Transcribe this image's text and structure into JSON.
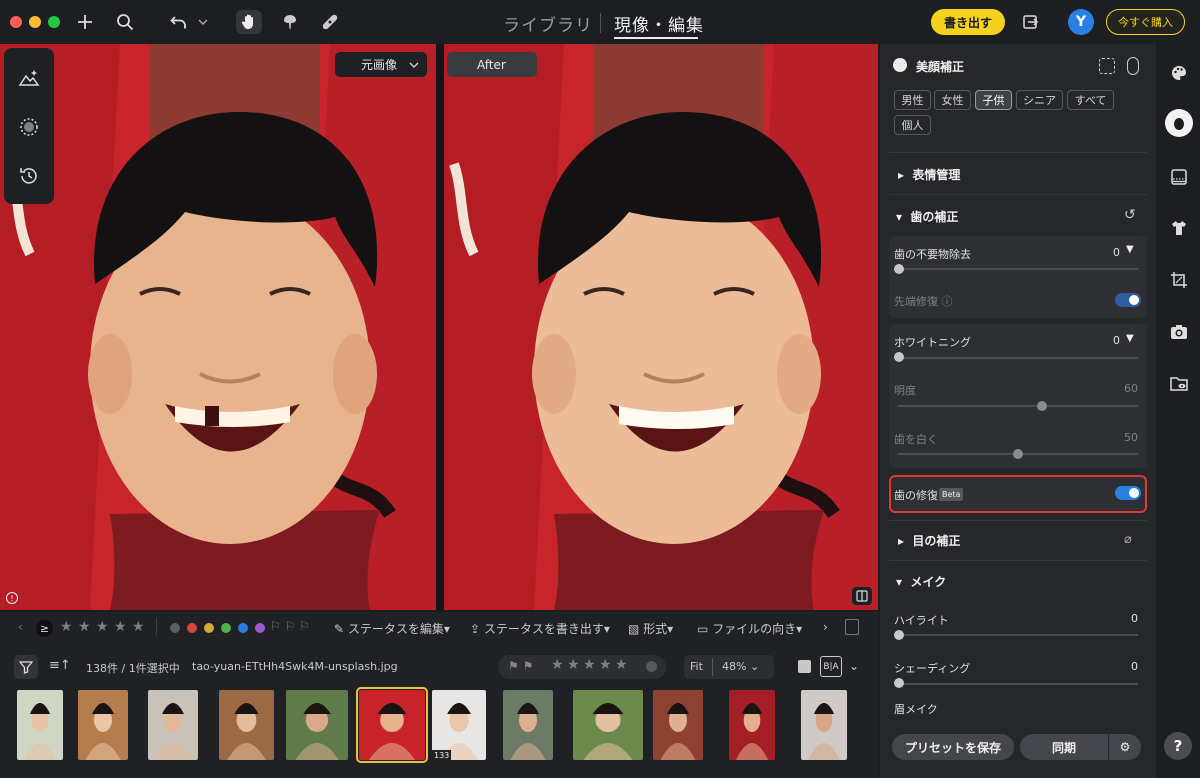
{
  "window": {
    "traffic_colors": [
      "#ff5f57",
      "#febc2e",
      "#28c840"
    ]
  },
  "toolbar": {
    "add_icon": "plus-icon",
    "search_icon": "search-icon",
    "undo_icon": "undo-icon",
    "tools": [
      "hand-icon",
      "brush-icon",
      "bandage-icon"
    ],
    "tabs": [
      {
        "label": "ライブラリ",
        "active": false
      },
      {
        "label": "現像・編集",
        "active": true
      }
    ],
    "export_label": "書き出す",
    "avatar_letter": "Y",
    "buy_label": "今すぐ購入"
  },
  "viewer": {
    "original_select": "元画像",
    "after_label": "After",
    "left_tools": [
      "landscape-ai-icon",
      "radial-icon",
      "history-icon"
    ]
  },
  "filmbar": {
    "filter_op": "≥",
    "color_labels": [
      "#5b5d62",
      "#d9463c",
      "#d9a93a",
      "#4fb24c",
      "#2b7de0",
      "#9b59d0"
    ],
    "actions": [
      "ステータスを編集",
      "ステータスを書き出す",
      "形式",
      "ファイルの向き"
    ],
    "count_text": "138件 / 1件選択中",
    "filename": "tao-yuan-ETtHh4Swk4M-unsplash.jpg",
    "fit_label": "Fit",
    "zoom_label": "48%",
    "thumb_badge": "133",
    "thumbnails": [
      {
        "bg": "#cfd6c3",
        "skin": "#e8c3a4"
      },
      {
        "bg": "#b57c4e",
        "skin": "#e9c6a8"
      },
      {
        "bg": "#c9c2b8",
        "skin": "#e2b897"
      },
      {
        "bg": "#9b6a45",
        "skin": "#e5bb9c"
      },
      {
        "bg": "#5f7b4a",
        "skin": "#d9a98a"
      },
      {
        "bg": "#c8232b",
        "skin": "#e5b38e"
      },
      {
        "bg": "#e8e6e4",
        "skin": "#ebc6a8"
      },
      {
        "bg": "#6b7b66",
        "skin": "#dcb08f"
      },
      {
        "bg": "#6c8a4b",
        "skin": "#e5c1a3"
      },
      {
        "bg": "#8e4130",
        "skin": "#e0b190"
      },
      {
        "bg": "#a51e25",
        "skin": "#e2b08c"
      },
      {
        "bg": "#cfcac5",
        "skin": "#d8a886"
      }
    ]
  },
  "panel": {
    "beauty": {
      "title": "美顔補正",
      "chips": [
        {
          "label": "男性",
          "active": false
        },
        {
          "label": "女性",
          "active": false
        },
        {
          "label": "子供",
          "active": true
        },
        {
          "label": "シニア",
          "active": false
        },
        {
          "label": "すべて",
          "active": false
        },
        {
          "label": "個人",
          "active": false
        }
      ]
    },
    "expression_title": "表情管理",
    "teeth": {
      "title": "歯の補正",
      "remove_label": "歯の不要物除去",
      "remove_value": "0",
      "tip_label": "先端修復",
      "whitening_label": "ホワイトニング",
      "whitening_value": "0",
      "brightness_label": "明度",
      "brightness_value": "60",
      "brightness": 60,
      "whiten_label": "歯を白く",
      "whiten_value": "50",
      "whiten": 50,
      "repair_label": "歯の修復",
      "beta_badge": "Beta",
      "highlight_color": "#e0392f"
    },
    "eye_title": "目の補正",
    "makeup": {
      "title": "メイク",
      "highlight_label": "ハイライト",
      "highlight_value": "0",
      "shading_label": "シェーディング",
      "shading_value": "0",
      "brow_label": "眉メイク"
    },
    "save_preset": "プリセットを保存",
    "sync": "同期",
    "help": "?"
  },
  "rail_icons": [
    "palette-icon",
    "face-icon",
    "gradient-icon",
    "shirt-icon",
    "crop-icon",
    "camera-icon",
    "folder-eye-icon"
  ]
}
